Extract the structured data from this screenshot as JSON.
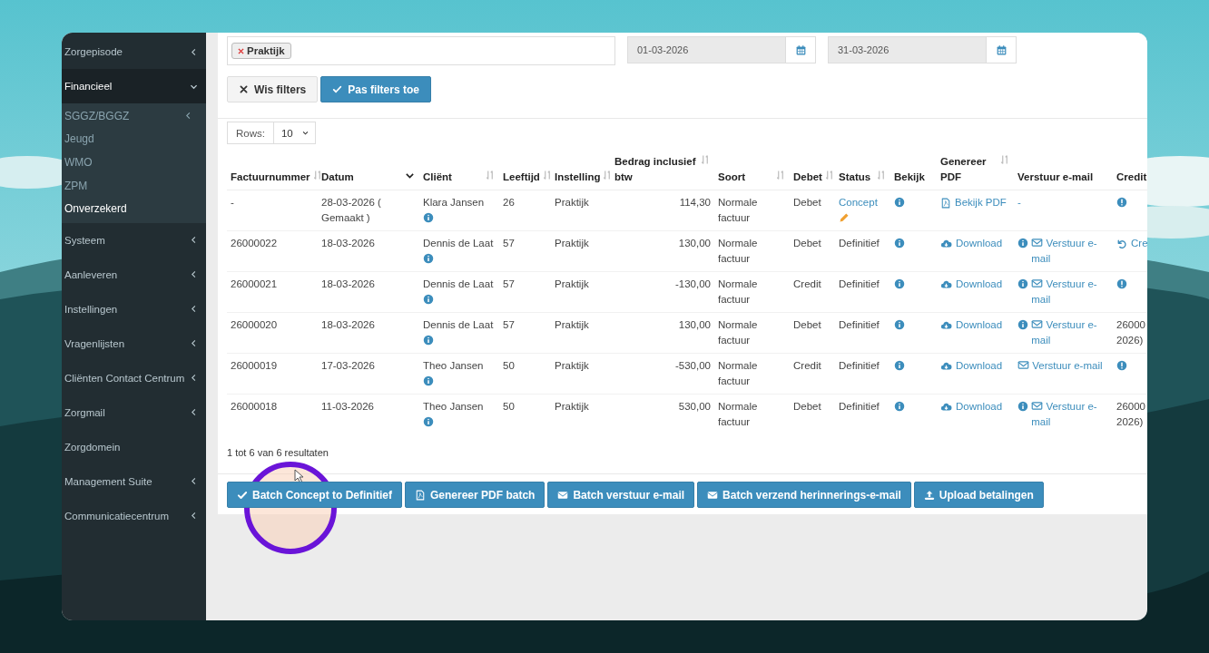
{
  "sidebar": {
    "items": [
      {
        "label": "Zorgepisode",
        "expanded": false,
        "selected": false
      },
      {
        "label": "Financieel",
        "expanded": true,
        "selected": false,
        "children": [
          {
            "label": "SGGZ/BGGZ",
            "expanded": false,
            "selected": false
          },
          {
            "label": "Jeugd",
            "selected": false
          },
          {
            "label": "WMO",
            "selected": false
          },
          {
            "label": "ZPM",
            "selected": false
          },
          {
            "label": "Onverzekerd",
            "selected": true
          }
        ]
      },
      {
        "label": "Systeem",
        "expanded": false,
        "selected": false
      },
      {
        "label": "Aanleveren",
        "expanded": false,
        "selected": false
      },
      {
        "label": "Instellingen",
        "expanded": false,
        "selected": false
      },
      {
        "label": "Vragenlijsten",
        "expanded": false,
        "selected": false
      },
      {
        "label": "Cliënten Contact Centrum",
        "expanded": false,
        "selected": false
      },
      {
        "label": "Zorgmail",
        "expanded": false,
        "selected": false
      },
      {
        "label": "Zorgdomein",
        "selected": false
      },
      {
        "label": "Management Suite",
        "expanded": false,
        "selected": false
      },
      {
        "label": "Communicatiecentrum",
        "expanded": false,
        "selected": false
      }
    ]
  },
  "filters": {
    "tags": [
      "Praktijk"
    ],
    "date_from": "01-03-2026",
    "date_to": "31-03-2026",
    "buttons": [
      {
        "label": "Wis filters",
        "kind": "default"
      },
      {
        "label": "Pas filters toe",
        "kind": "primary"
      }
    ]
  },
  "rows_select": {
    "label": "Rows:",
    "value": "10"
  },
  "table": {
    "columns": [
      {
        "label": "Factuurnummer",
        "sortable": true,
        "sorted": false
      },
      {
        "label": "Datum",
        "sorted": true
      },
      {
        "label": "Cliënt",
        "sortable": true,
        "sorted": false
      },
      {
        "label": "Leeftijd",
        "sortable": true,
        "sorted": false
      },
      {
        "label": "Instelling",
        "sortable": true,
        "sorted": false
      },
      {
        "label": "Bedrag inclusief btw",
        "sortable": true,
        "sorted": false
      },
      {
        "label": "Soort",
        "sortable": true,
        "sorted": false
      },
      {
        "label": "Debet",
        "sortable": true,
        "sorted": false
      },
      {
        "label": "Status",
        "sortable": true,
        "sorted": false
      },
      {
        "label": "Bekijk",
        "sortable": false,
        "sorted": false
      },
      {
        "label": "Genereer PDF",
        "sortable": true,
        "sorted": false
      },
      {
        "label": "Verstuur e-mail",
        "sortable": false,
        "sorted": false
      },
      {
        "label": "Credit"
      }
    ],
    "rows": [
      {
        "number": "-",
        "date": "28-03-2026 ( Gemaakt )",
        "client": "Klara Jansen",
        "age": "26",
        "instelling": "Praktijk",
        "amount": "114,30",
        "soort": "Normale factuur",
        "debet": "Debet",
        "status": {
          "kind": "concept",
          "text": "Concept"
        },
        "pdf": {
          "kind": "view",
          "text": "Bekijk PDF"
        },
        "email": {
          "kind": "none",
          "text": "-"
        },
        "credit": {
          "kind": "alert"
        }
      },
      {
        "number": "26000022",
        "date": "18-03-2026",
        "client": "Dennis de Laat",
        "age": "57",
        "instelling": "Praktijk",
        "amount": "130,00",
        "soort": "Normale factuur",
        "debet": "Debet",
        "status": {
          "kind": "final",
          "text": "Definitief"
        },
        "pdf": {
          "kind": "download",
          "text": "Download"
        },
        "email": {
          "kind": "link",
          "info": true,
          "text": "Verstuur e-mail"
        },
        "credit": {
          "kind": "undo",
          "text": "Cre"
        }
      },
      {
        "number": "26000021",
        "date": "18-03-2026",
        "client": "Dennis de Laat",
        "age": "57",
        "instelling": "Praktijk",
        "amount": "-130,00",
        "soort": "Normale factuur",
        "debet": "Credit",
        "status": {
          "kind": "final",
          "text": "Definitief"
        },
        "pdf": {
          "kind": "download",
          "text": "Download"
        },
        "email": {
          "kind": "link",
          "info": true,
          "text": "Verstuur e-mail"
        },
        "credit": {
          "kind": "alert"
        }
      },
      {
        "number": "26000020",
        "date": "18-03-2026",
        "client": "Dennis de Laat",
        "age": "57",
        "instelling": "Praktijk",
        "amount": "130,00",
        "soort": "Normale factuur",
        "debet": "Debet",
        "status": {
          "kind": "final",
          "text": "Definitief"
        },
        "pdf": {
          "kind": "download",
          "text": "Download"
        },
        "email": {
          "kind": "link",
          "info": true,
          "text": "Verstuur e-mail"
        },
        "credit": {
          "kind": "text",
          "lines": [
            "26000",
            "2026)"
          ]
        }
      },
      {
        "number": "26000019",
        "date": "17-03-2026",
        "client": "Theo Jansen",
        "age": "50",
        "instelling": "Praktijk",
        "amount": "-530,00",
        "soort": "Normale factuur",
        "debet": "Credit",
        "status": {
          "kind": "final",
          "text": "Definitief"
        },
        "pdf": {
          "kind": "download",
          "text": "Download"
        },
        "email": {
          "kind": "link",
          "info": false,
          "text": "Verstuur e-mail"
        },
        "credit": {
          "kind": "alert"
        }
      },
      {
        "number": "26000018",
        "date": "11-03-2026",
        "client": "Theo Jansen",
        "age": "50",
        "instelling": "Praktijk",
        "amount": "530,00",
        "soort": "Normale factuur",
        "debet": "Debet",
        "status": {
          "kind": "final",
          "text": "Definitief"
        },
        "pdf": {
          "kind": "download",
          "text": "Download"
        },
        "email": {
          "kind": "link",
          "info": true,
          "text": "Verstuur e-mail"
        },
        "credit": {
          "kind": "text",
          "lines": [
            "26000",
            "2026)"
          ]
        }
      }
    ]
  },
  "summary": "1 tot 6 van 6 resultaten",
  "actions": [
    {
      "label": "Batch Concept to Definitief"
    },
    {
      "label": "Genereer PDF batch"
    },
    {
      "label": "Batch verstuur e-mail"
    },
    {
      "label": "Batch verzend herinnerings-e-mail"
    },
    {
      "label": "Upload betalingen"
    }
  ]
}
